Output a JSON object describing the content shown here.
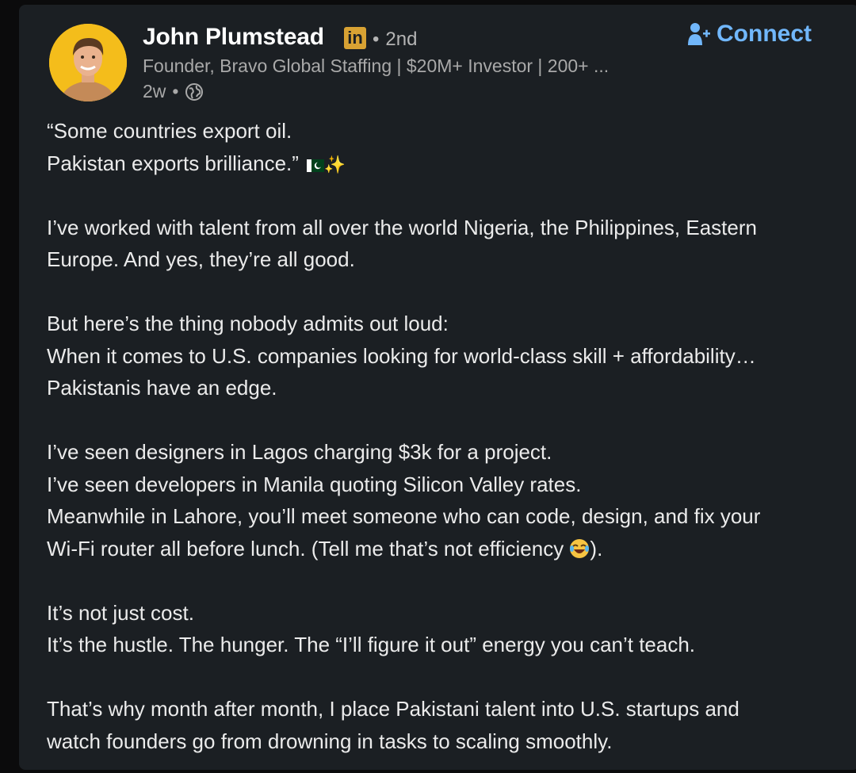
{
  "author": {
    "name": "John Plumstead",
    "badge": "in",
    "degree": "2nd",
    "headline": "Founder, Bravo Global Staffing | $20M+ Investor | 200+ ...",
    "time": "2w",
    "visibility_icon": "globe-icon"
  },
  "actions": {
    "connect_label": "Connect",
    "connect_icon": "add-person-icon"
  },
  "colors": {
    "card_bg": "#1b1f23",
    "accent_link": "#71b7fb",
    "badge": "#d8a233",
    "avatar_bg": "#f4bd1b"
  },
  "post": {
    "p1": {
      "line1": "“Some countries export oil.",
      "line2": "Pakistan exports brilliance.”",
      "emoji": "✨"
    },
    "p2": {
      "line1": "I’ve worked with talent from all over the world Nigeria, the Philippines, Eastern",
      "line2": "Europe. And yes, they’re all good."
    },
    "p3": {
      "line1": "But here’s the thing nobody admits out loud:",
      "line2": "When it comes to U.S. companies looking for world-class skill + affordability…",
      "line3": "Pakistanis have an edge."
    },
    "p4": {
      "line1": "I’ve seen designers in Lagos charging $3k for a project.",
      "line2": "I’ve seen developers in Manila quoting Silicon Valley rates.",
      "line3": "Meanwhile in Lahore, you’ll meet someone who can code, design, and fix your",
      "line4a": "Wi-Fi router all before lunch. (Tell me that’s not efficiency ",
      "line4b": ")."
    },
    "p5": {
      "line1": "It’s not just cost.",
      "line2": "It’s the hustle. The hunger. The “I’ll figure it out” energy you can’t teach."
    },
    "p6": {
      "line1": "That’s why month after month, I place Pakistani talent into U.S. startups and",
      "line2": "watch founders go from drowning in tasks to scaling smoothly."
    }
  }
}
